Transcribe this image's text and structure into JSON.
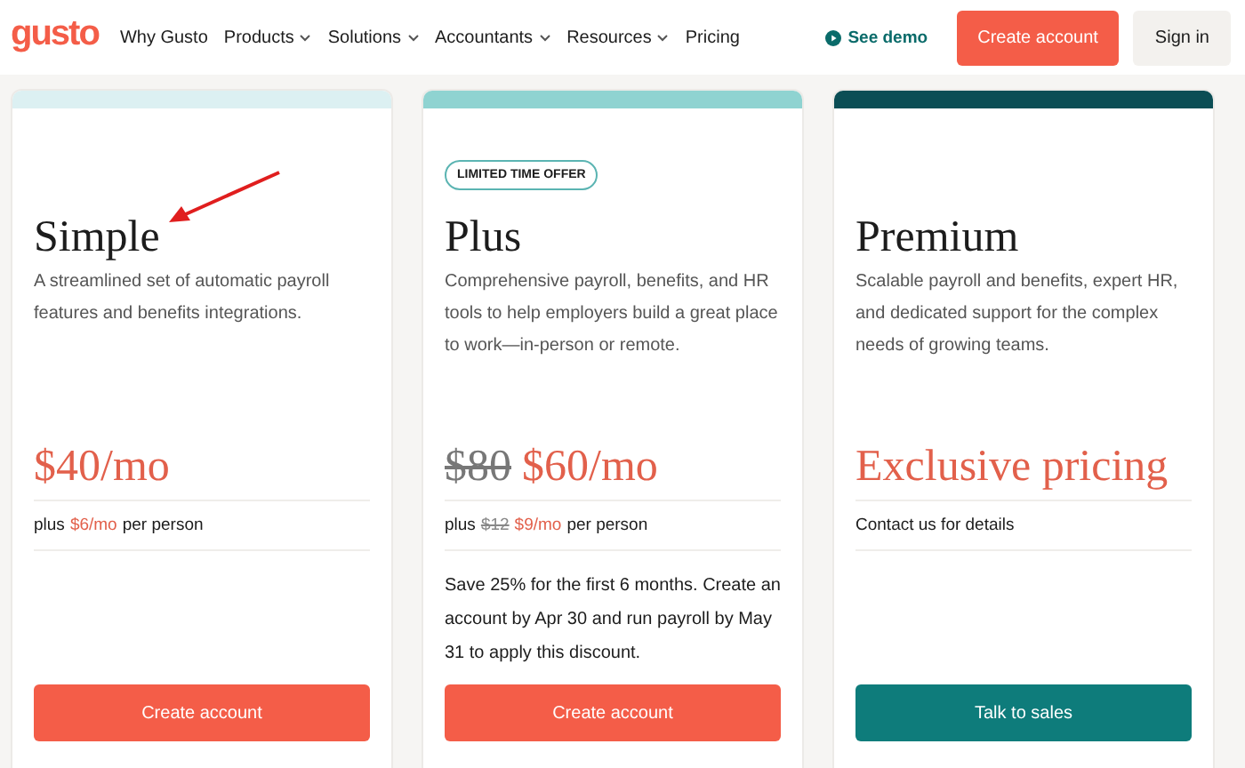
{
  "header": {
    "logo": "gusto",
    "nav": [
      {
        "label": "Why Gusto",
        "has_menu": false
      },
      {
        "label": "Products",
        "has_menu": true
      },
      {
        "label": "Solutions",
        "has_menu": true
      },
      {
        "label": "Accountants",
        "has_menu": true
      },
      {
        "label": "Resources",
        "has_menu": true
      },
      {
        "label": "Pricing",
        "has_menu": false
      }
    ],
    "demo": "See demo",
    "create": "Create account",
    "signin": "Sign in"
  },
  "plans": [
    {
      "color": "#dcf0f2",
      "name": "Simple",
      "description": "A streamlined set of automatic payroll features and benefits integrations.",
      "price": "$40/mo",
      "per_person": {
        "prefix": "plus",
        "price": "$6/mo",
        "suffix": "per person"
      },
      "button": {
        "label": "Create account",
        "kind": "primary"
      },
      "annotated": true
    },
    {
      "color": "#8fd3d1",
      "badge": "LIMITED TIME OFFER",
      "name": "Plus",
      "description": "Comprehensive payroll, benefits, and HR tools to help employers build a great place to work—in-person or remote.",
      "old_price": "$80",
      "price": "$60/mo",
      "per_person": {
        "prefix": "plus",
        "old_price": "$12",
        "price": "$9/mo",
        "suffix": "per person"
      },
      "note": "Save 25% for the first 6 months. Create an account by Apr 30 and run payroll by May 31 to apply this discount.",
      "button": {
        "label": "Create account",
        "kind": "primary"
      },
      "annotated": false
    },
    {
      "color": "#0b4e55",
      "name": "Premium",
      "description": "Scalable payroll and benefits, expert HR, and dedicated support for the complex needs of growing teams.",
      "price": "Exclusive pricing",
      "contact": "Contact us for details",
      "button": {
        "label": "Talk to sales",
        "kind": "secondary"
      },
      "annotated": false
    }
  ]
}
